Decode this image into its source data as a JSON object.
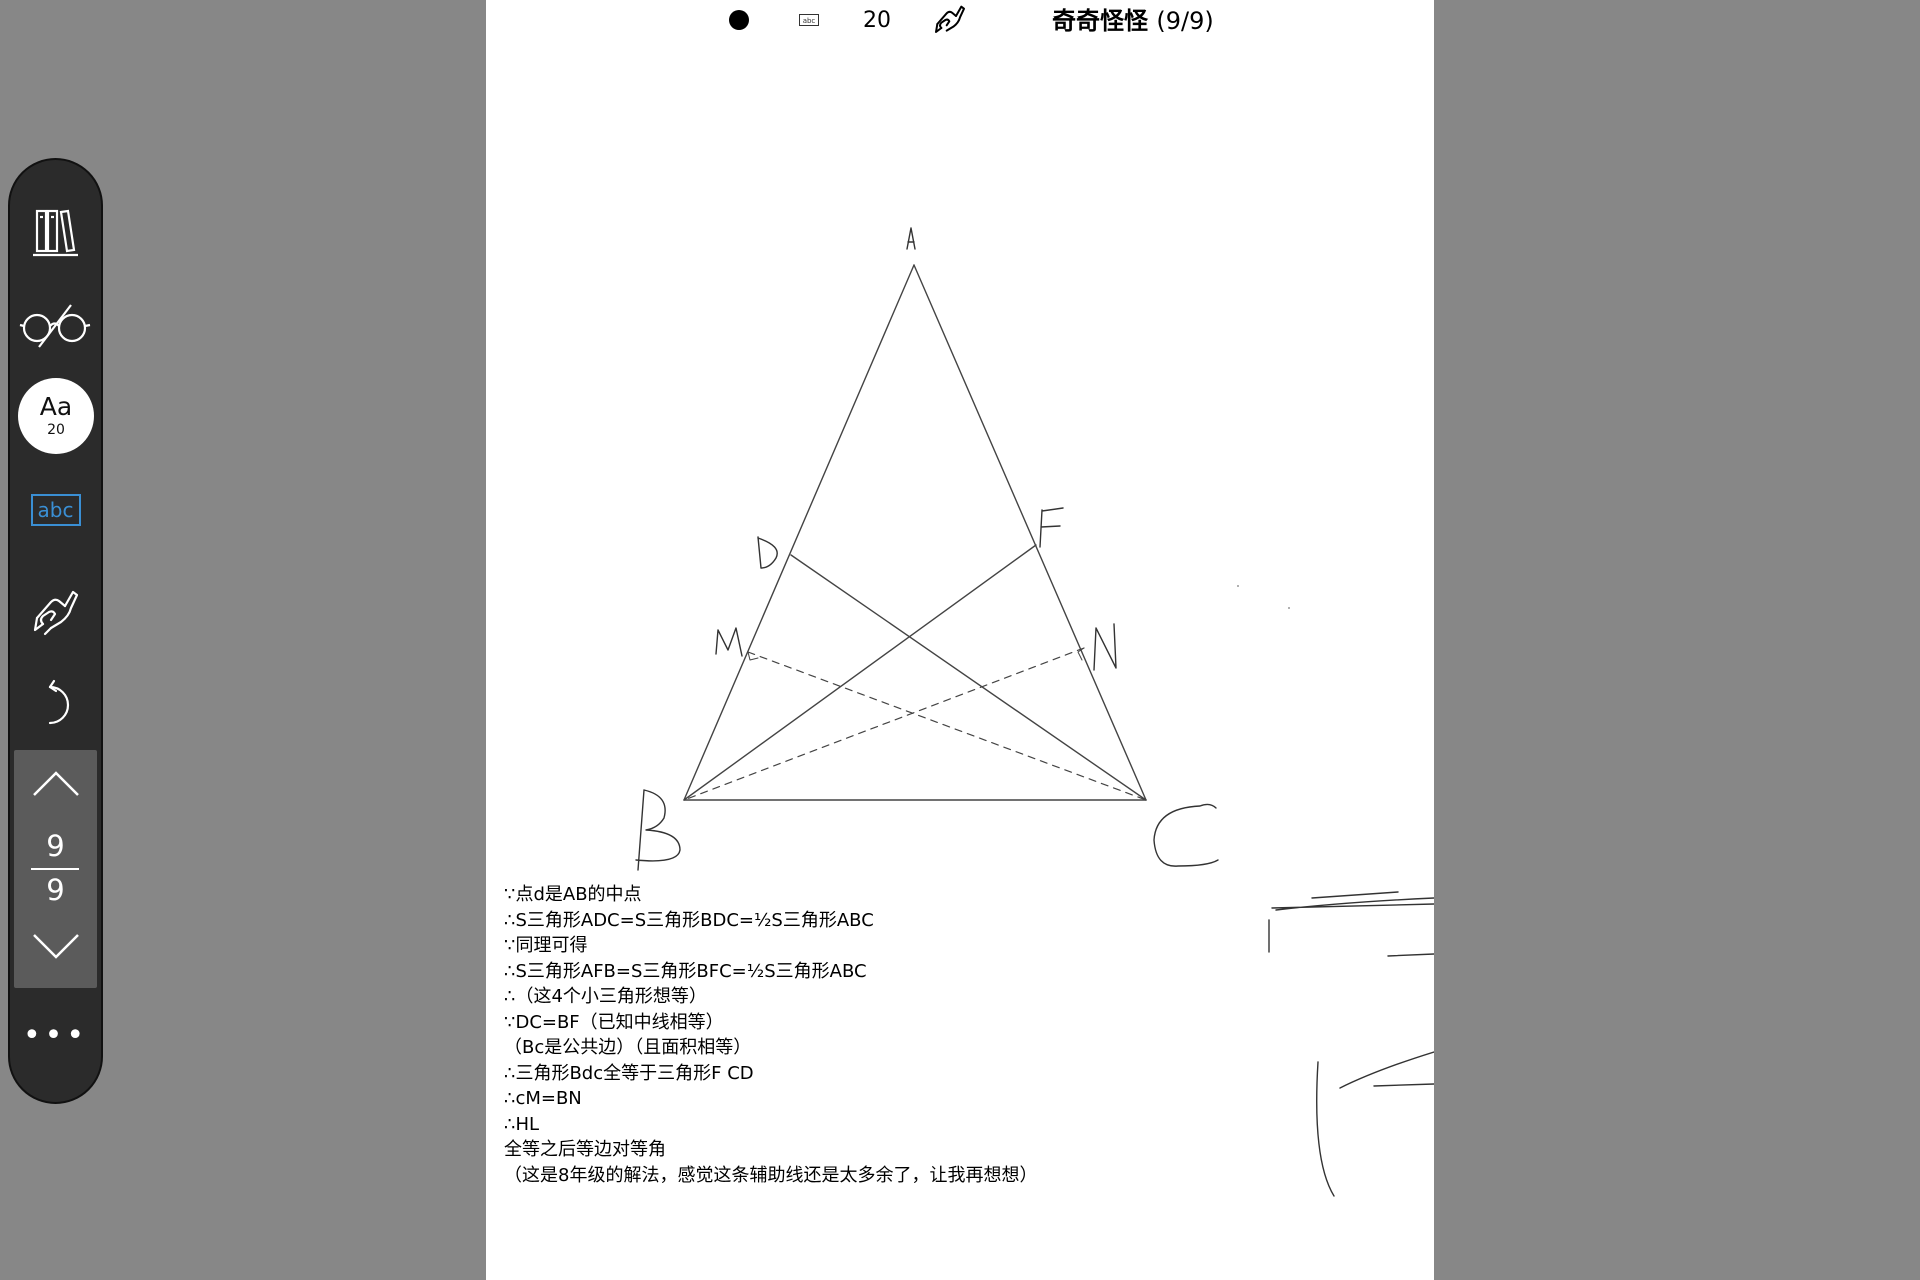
{
  "toolbar": {
    "icons": {
      "library": "library-books-icon",
      "reading": "glasses-icon",
      "text_box": "abc-textbox-icon",
      "hand_write": "hand-pen-icon",
      "undo": "undo-icon",
      "page_up": "chevron-up-icon",
      "page_down": "chevron-down-icon",
      "more": "more-dots-icon"
    },
    "font_sample": "Aa",
    "font_size": "20",
    "text_box_label": "abc",
    "current_page": "9",
    "total_pages": "9",
    "more_label": "•••"
  },
  "status_bar": {
    "text_box_label": "abc",
    "font_size": "20",
    "title": "奇奇怪怪",
    "page_count": "(9/9)"
  },
  "diagram": {
    "labels": {
      "a": "A",
      "b": "B",
      "c": "C",
      "d": "D",
      "f": "F",
      "m": "M",
      "n": "N"
    }
  },
  "proof_lines": [
    "∵点d是AB的中点",
    "∴S三角形ADC=S三角形BDC=½S三角形ABC",
    "∵同理可得",
    "∴S三角形AFB=S三角形BFC=½S三角形ABC",
    "∴（这4个小三角形想等）",
    "∵DC=BF（已知中线相等）",
    "（Bc是公共边）（且面积相等）",
    "∴三角形Bdc全等于三角形F CD",
    "∴cM=BN",
    "∴HL",
    "全等之后等边对等角",
    "（这是8年级的解法，感觉这条辅助线还是太多余了，让我再想想）"
  ],
  "colors": {
    "background": "#878787",
    "toolbar": "#2b2b2b",
    "pager": "#5b5b5b",
    "accent_blue": "#3a8fd4",
    "page": "#ffffff"
  }
}
